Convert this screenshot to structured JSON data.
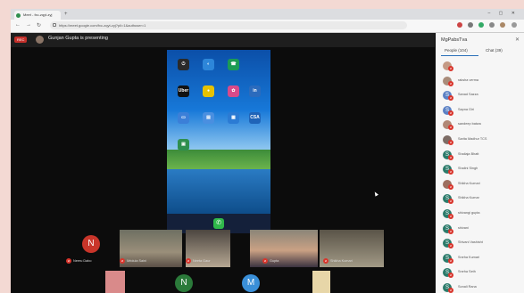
{
  "browser": {
    "tab_title": "Meet - fxc-zqyt-zyj",
    "new_tab": "+",
    "window_controls": "– ▢ ✕",
    "url": "https://meet.google.com/fxc-zqyt-zyj?pli=1&authuser=1",
    "nav_back": "←",
    "nav_forward": "→",
    "nav_reload": "↻"
  },
  "meeting": {
    "rec_badge": "REC",
    "presenting_text": "Gunjan Gupta is presenting"
  },
  "phone": {
    "apps": [
      {
        "icon": "power-icon",
        "glyph": "⏻",
        "label": ""
      },
      {
        "icon": "browser-icon",
        "glyph": "◐",
        "label": ""
      },
      {
        "icon": "chat-icon",
        "glyph": "☎",
        "label": ""
      },
      {
        "icon": "uber-icon",
        "glyph": "Uber",
        "label": ""
      },
      {
        "icon": "camera-icon",
        "glyph": "●",
        "label": ""
      },
      {
        "icon": "game-icon",
        "glyph": "✿",
        "label": ""
      },
      {
        "icon": "linkedin-icon",
        "glyph": "in",
        "label": ""
      },
      {
        "icon": "files-icon",
        "glyph": "▭",
        "label": ""
      },
      {
        "icon": "docs-icon",
        "glyph": "▤",
        "label": ""
      },
      {
        "icon": "calendar-icon",
        "glyph": "▦",
        "label": ""
      },
      {
        "icon": "csa-icon",
        "glyph": "CSA",
        "label": ""
      },
      {
        "icon": "classroom-icon",
        "glyph": "▣",
        "label": ""
      }
    ],
    "dock_icon": "phone-icon",
    "dock_glyph": "✆"
  },
  "sidebar": {
    "title": "MgPabsTva",
    "close": "✕",
    "tab_people": "People (104)",
    "tab_chat": "Chat (39)",
    "people": [
      {
        "initial": "",
        "color": "#c49a85",
        "name": ""
      },
      {
        "initial": "",
        "color": "#a98c7a",
        "name": "raksha verma"
      },
      {
        "initial": "S",
        "color": "#5a80c4",
        "name": "Sanad Sazza"
      },
      {
        "initial": "S",
        "color": "#5a80c4",
        "name": "Sapna Giri"
      },
      {
        "initial": "",
        "color": "#b08876",
        "name": "sandeep batwa"
      },
      {
        "initial": "",
        "color": "#7c6c65",
        "name": "Sarita Madhur TCS"
      },
      {
        "initial": "S",
        "color": "#2b7a6a",
        "name": "Shailaja Bhatt"
      },
      {
        "initial": "S",
        "color": "#2b7a6a",
        "name": "Shalini Singh"
      },
      {
        "initial": "",
        "color": "#9c6f5f",
        "name": "Shikha Kumari"
      },
      {
        "initial": "S",
        "color": "#2b7a6a",
        "name": "Shikha Kumar"
      },
      {
        "initial": "S",
        "color": "#2b7a6a",
        "name": "shivangi gupta"
      },
      {
        "initial": "S",
        "color": "#2b7a6a",
        "name": "shivani"
      },
      {
        "initial": "S",
        "color": "#2b7a6a",
        "name": "Shivani Vashisht"
      },
      {
        "initial": "S",
        "color": "#2b7a6a",
        "name": "Sneha Kumari"
      },
      {
        "initial": "S",
        "color": "#2b7a6a",
        "name": "Sneha Seth"
      },
      {
        "initial": "S",
        "color": "#2b7a6a",
        "name": "Sonali Rana"
      }
    ]
  },
  "tiles": [
    {
      "kind": "avatar",
      "initial": "N",
      "color": "#c9352a",
      "name": "Neeru Dabo"
    },
    {
      "kind": "video",
      "name": "Mridula Saini"
    },
    {
      "kind": "video",
      "name": "Neeta Gaur"
    },
    {
      "kind": "video",
      "name": "Gupta"
    },
    {
      "kind": "video",
      "name": "Shikha Kumari"
    },
    {
      "kind": "avatar",
      "initial": "N",
      "color": "#2b7a3a",
      "name": ""
    },
    {
      "kind": "avatar",
      "initial": "M",
      "color": "#3a8fd8",
      "name": ""
    }
  ]
}
